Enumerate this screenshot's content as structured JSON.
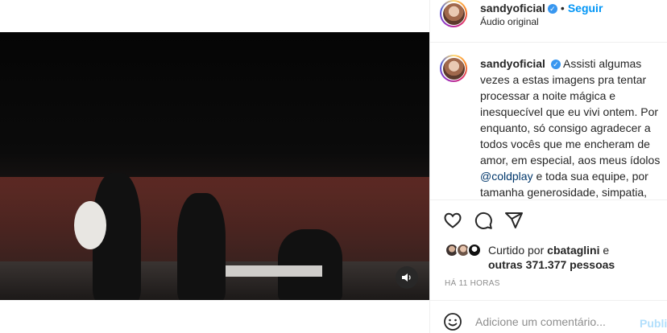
{
  "post": {
    "username": "sandyoficial",
    "verified_badge": "✓",
    "dot": "•",
    "follow_label": "Seguir",
    "audio_label": "Áudio original"
  },
  "caption": {
    "username": "sandyoficial",
    "text_before_mention": "Assisti algumas vezes a estas imagens pra tentar processar a noite mágica e inesquecível que eu vivi ontem. Por enquanto, só consigo agradecer a todos vocês que me encheram de amor, em especial, aos meus ídolos",
    "mention": "@coldplay",
    "text_after_mention": "e toda sua equipe, por tamanha generosidade, simpatia, profissionalismo e carinho... Vou"
  },
  "actions": {
    "like_icon": "heart-icon",
    "comment_icon": "comment-icon",
    "share_icon": "share-icon"
  },
  "likes": {
    "prefix": "Curtido por",
    "user": "cbataglini",
    "suffix": "e",
    "others": "outras 371.377 pessoas"
  },
  "timestamp": "HÁ 11 HORAS",
  "comment": {
    "placeholder": "Adicione um comentário...",
    "publish_label": "Publi",
    "emoji_icon": "smiley-icon"
  },
  "video": {
    "sound_icon": "speaker-icon"
  },
  "colors": {
    "accent": "#0095f6",
    "verified": "#3897f0",
    "mention": "#00376b",
    "muted_text": "#8e8e8e",
    "publish_disabled": "#b2dffc"
  }
}
